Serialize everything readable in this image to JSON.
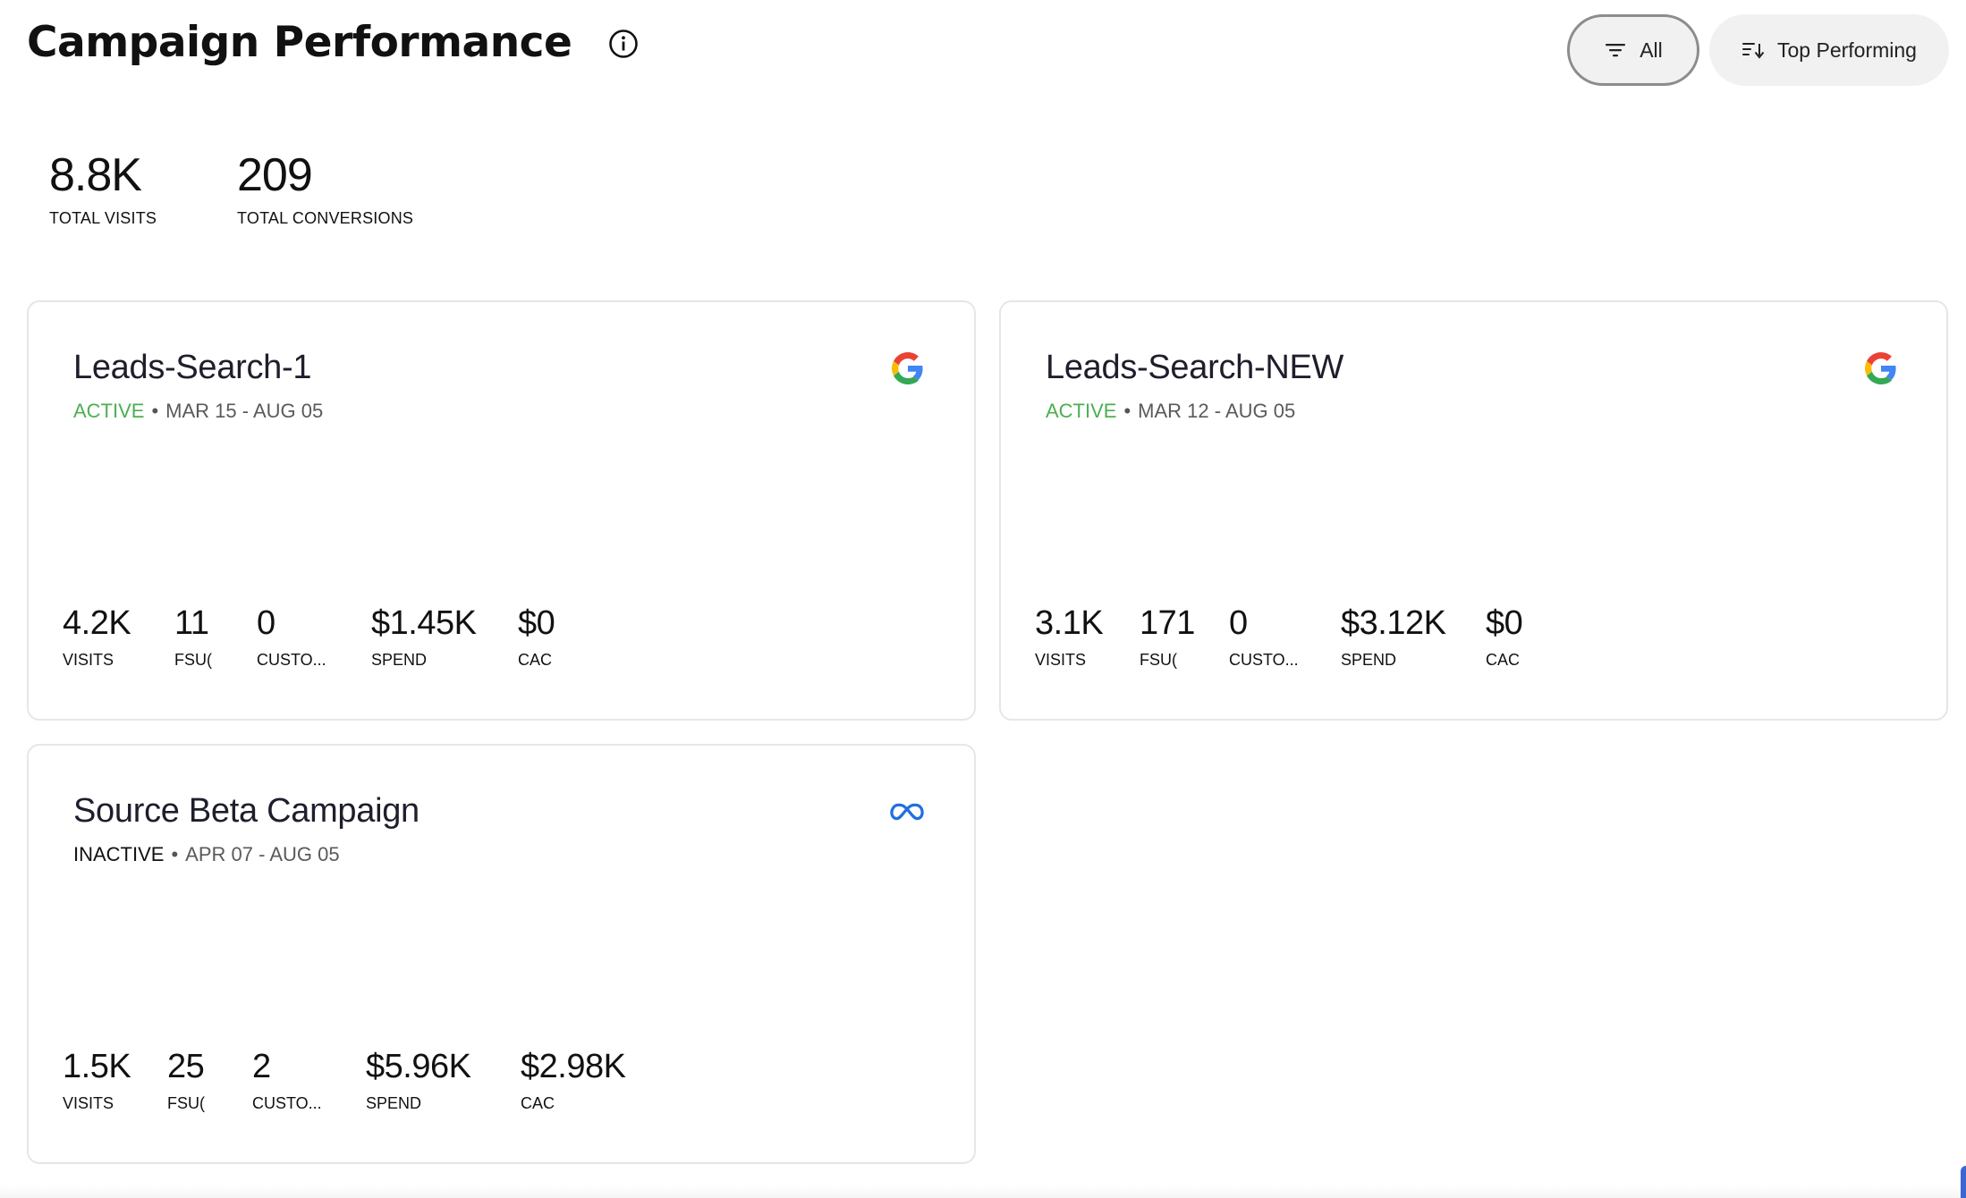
{
  "header": {
    "title": "Campaign Performance",
    "filter_all_label": "All",
    "sort_label": "Top Performing"
  },
  "totals": {
    "visits_value": "8.8K",
    "visits_label": "TOTAL VISITS",
    "conversions_value": "209",
    "conversions_label": "TOTAL CONVERSIONS"
  },
  "campaigns": [
    {
      "name": "Leads-Search-1",
      "status": "ACTIVE",
      "date_range": "MAR 15 - AUG 05",
      "platform_icon": "google-icon",
      "metrics": [
        {
          "value": "4.2K",
          "label": "VISITS"
        },
        {
          "value": "11",
          "label": "FSU("
        },
        {
          "value": "0",
          "label": "CUSTO..."
        },
        {
          "value": "$1.45K",
          "label": "SPEND"
        },
        {
          "value": "$0",
          "label": "CAC"
        }
      ]
    },
    {
      "name": "Leads-Search-NEW",
      "status": "ACTIVE",
      "date_range": "MAR 12 - AUG 05",
      "platform_icon": "google-icon",
      "metrics": [
        {
          "value": "3.1K",
          "label": "VISITS"
        },
        {
          "value": "171",
          "label": "FSU("
        },
        {
          "value": "0",
          "label": "CUSTO..."
        },
        {
          "value": "$3.12K",
          "label": "SPEND"
        },
        {
          "value": "$0",
          "label": "CAC"
        }
      ]
    },
    {
      "name": "Source Beta Campaign",
      "status": "INACTIVE",
      "date_range": "APR 07 - AUG 05",
      "platform_icon": "meta-icon",
      "metrics": [
        {
          "value": "1.5K",
          "label": "VISITS"
        },
        {
          "value": "25",
          "label": "FSU("
        },
        {
          "value": "2",
          "label": "CUSTO..."
        },
        {
          "value": "$5.96K",
          "label": "SPEND"
        },
        {
          "value": "$2.98K",
          "label": "CAC"
        }
      ]
    }
  ],
  "colors": {
    "active": "#4caf50",
    "inactive": "#111111",
    "meta_blue": "#1f6fe0"
  }
}
